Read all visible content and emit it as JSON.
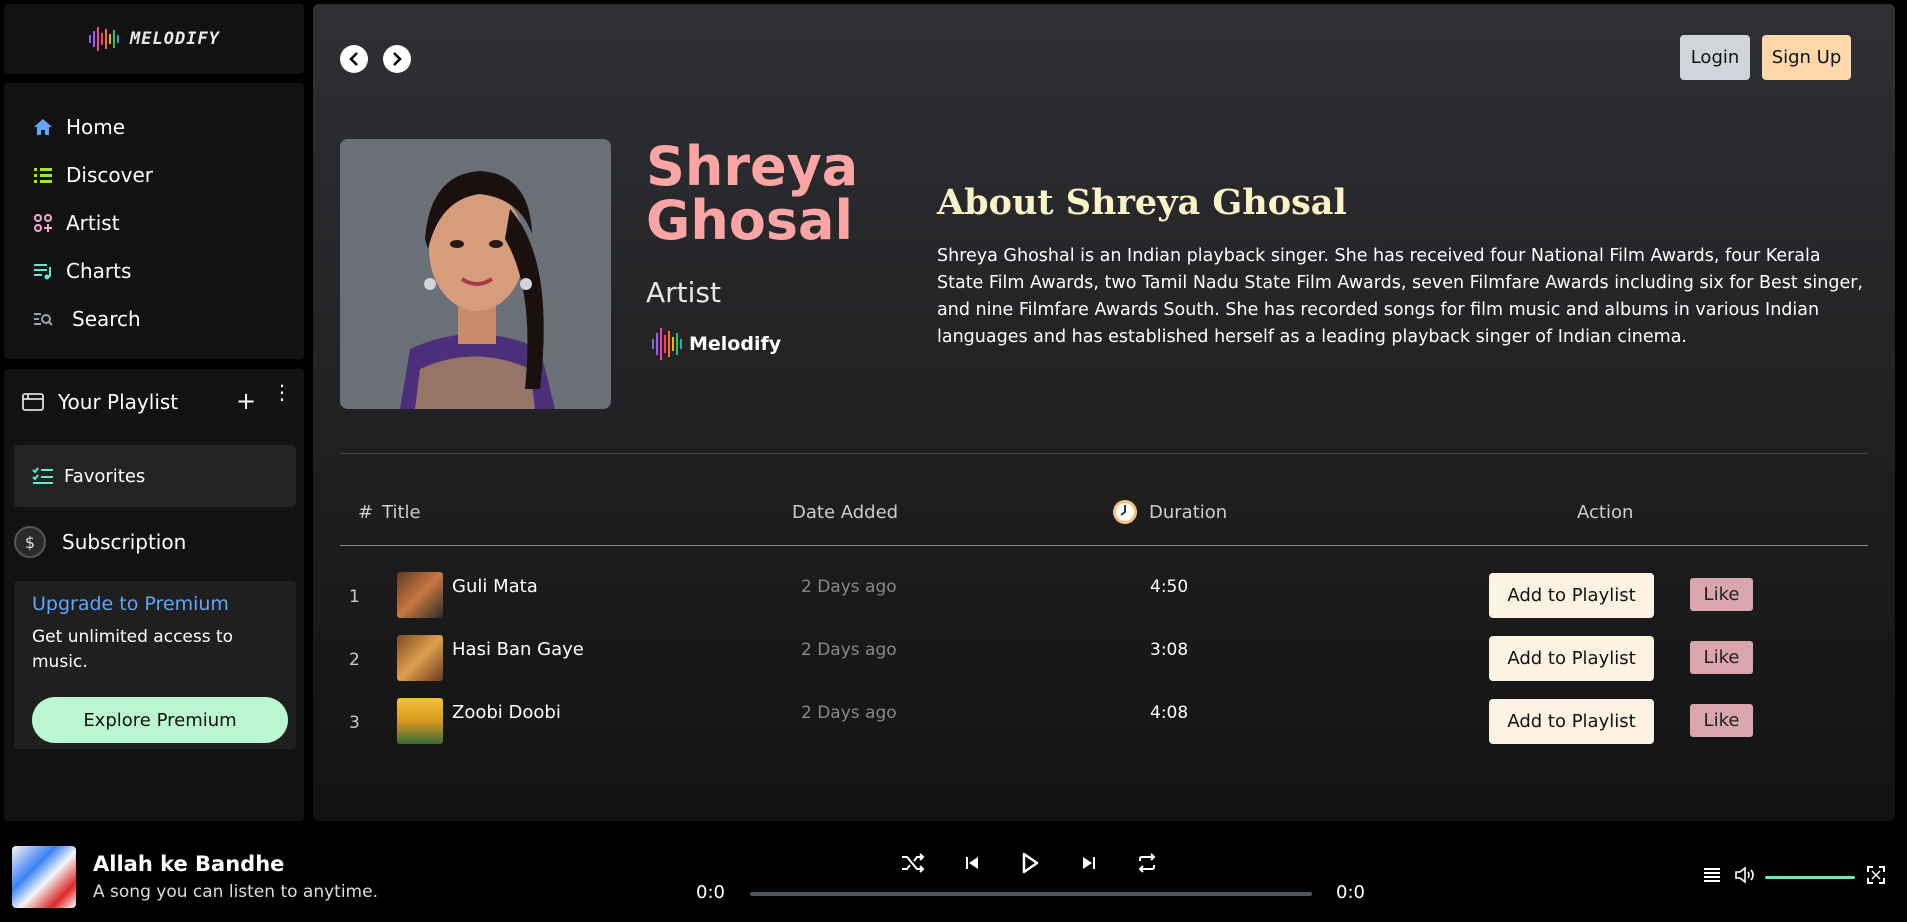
{
  "app": {
    "name": "MELODIFY"
  },
  "sidebar": {
    "nav": [
      {
        "label": "Home",
        "icon": "home-icon"
      },
      {
        "label": "Discover",
        "icon": "list-icon"
      },
      {
        "label": "Artist",
        "icon": "artist-icon"
      },
      {
        "label": "Charts",
        "icon": "music-list-icon"
      },
      {
        "label": "Search",
        "icon": "search-list-icon"
      }
    ],
    "playlist_header": "Your Playlist",
    "favorites": "Favorites",
    "subscription": "Subscription",
    "upgrade": {
      "title": "Upgrade to Premium",
      "text": "Get unlimited access to music.",
      "button": "Explore Premium"
    }
  },
  "header": {
    "login": "Login",
    "signup": "Sign Up"
  },
  "artist": {
    "name_line1": "Shreya",
    "name_line2": "Ghosal",
    "role": "Artist",
    "brand": "Melodify",
    "about_title": "About Shreya Ghosal",
    "about_text": "Shreya Ghoshal is an Indian playback singer. She has received four National Film Awards, four Kerala State Film Awards, two Tamil Nadu State Film Awards, seven Filmfare Awards including six for Best singer, and nine Filmfare Awards South. She has recorded songs for film music and albums in various Indian languages and has established herself as a leading playback singer of Indian cinema."
  },
  "table": {
    "headers": {
      "num": "#",
      "title": "Title",
      "date": "Date Added",
      "duration": "Duration",
      "action": "Action"
    },
    "rows": [
      {
        "num": "1",
        "title": "Guli Mata",
        "date": "2 Days ago",
        "duration": "4:50",
        "add": "Add to Playlist",
        "like": "Like"
      },
      {
        "num": "2",
        "title": "Hasi Ban Gaye",
        "date": "2 Days ago",
        "duration": "3:08",
        "add": "Add to Playlist",
        "like": "Like"
      },
      {
        "num": "3",
        "title": "Zoobi Doobi",
        "date": "2 Days ago",
        "duration": "4:08",
        "add": "Add to Playlist",
        "like": "Like"
      }
    ]
  },
  "player": {
    "title": "Allah ke Bandhe",
    "subtitle": "A song you can listen to anytime.",
    "current_time": "0:0",
    "total_time": "0:0"
  },
  "colors": {
    "artist_name": "#fca5a5",
    "about_title": "#fef3c7",
    "upgrade_title": "#60a5fa",
    "premium_button": "#bbf7d0",
    "signup": "#fed7aa",
    "like": "#d8a6ac"
  }
}
